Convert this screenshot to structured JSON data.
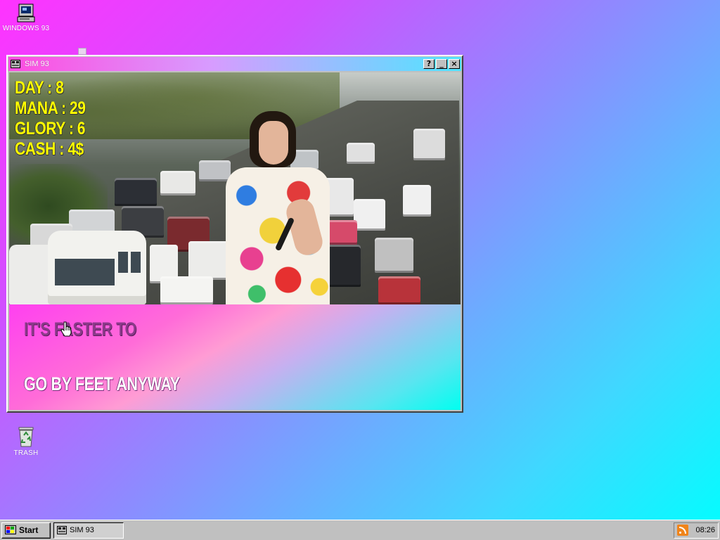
{
  "desktop": {
    "icons": [
      {
        "label": "WINDOWS 93",
        "icon": "computer-icon"
      },
      {
        "label": "TRASH",
        "icon": "recycle-bin-icon"
      }
    ]
  },
  "window": {
    "title": "SIM 93",
    "icon": "app-icon",
    "buttons": {
      "help": "?",
      "minimize": "_",
      "close": "×"
    }
  },
  "game": {
    "stats": {
      "day": "DAY : 8",
      "mana": "MANA : 29",
      "glory": "GLORY : 6",
      "cash": "CASH : 4$"
    },
    "choices": [
      {
        "label": "IT'S FASTER TO"
      },
      {
        "label": "GO BY FEET ANYWAY"
      }
    ],
    "colors": {
      "stats": "#ffff00",
      "choice_1": "#8b3a8a",
      "choice_2": "#ffffff"
    }
  },
  "taskbar": {
    "start_label": "Start",
    "tasks": [
      {
        "label": "SIM 93"
      }
    ],
    "clock": "08:26",
    "tray_icon": "rss-icon"
  }
}
